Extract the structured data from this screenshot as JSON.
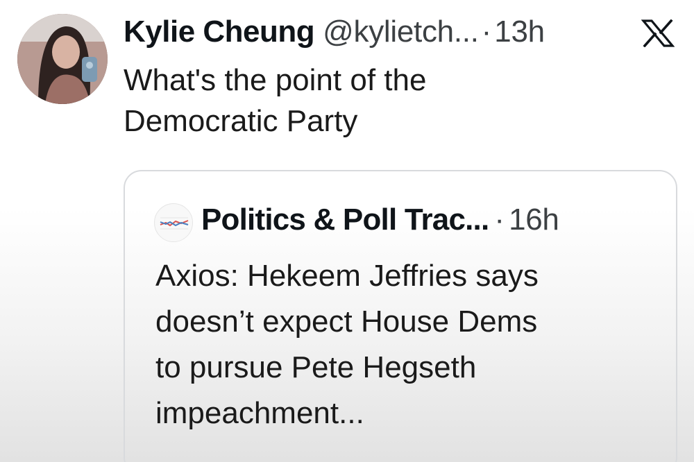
{
  "tweet": {
    "author_name": "Kylie Cheung",
    "author_handle": "@kylietch...",
    "separator": "·",
    "time": "13h",
    "text_lines": [
      "What's the point of the",
      "Democratic Party"
    ]
  },
  "quote": {
    "author_name": "Politics & Poll Trac...",
    "separator": "·",
    "time": "16h",
    "text_lines": [
      "Axios: Hekeem Jeffries says",
      "doesn’t expect House Dems",
      "to pursue Pete Hegseth",
      "impeachment..."
    ]
  },
  "icons": {
    "author_avatar": "profile-photo",
    "quote_avatar": "poll-chart-logo",
    "brand": "x-logo-icon"
  },
  "colors": {
    "text_primary": "#0f1419",
    "text_secondary": "#3c4043",
    "card_border": "#d8dadd"
  }
}
